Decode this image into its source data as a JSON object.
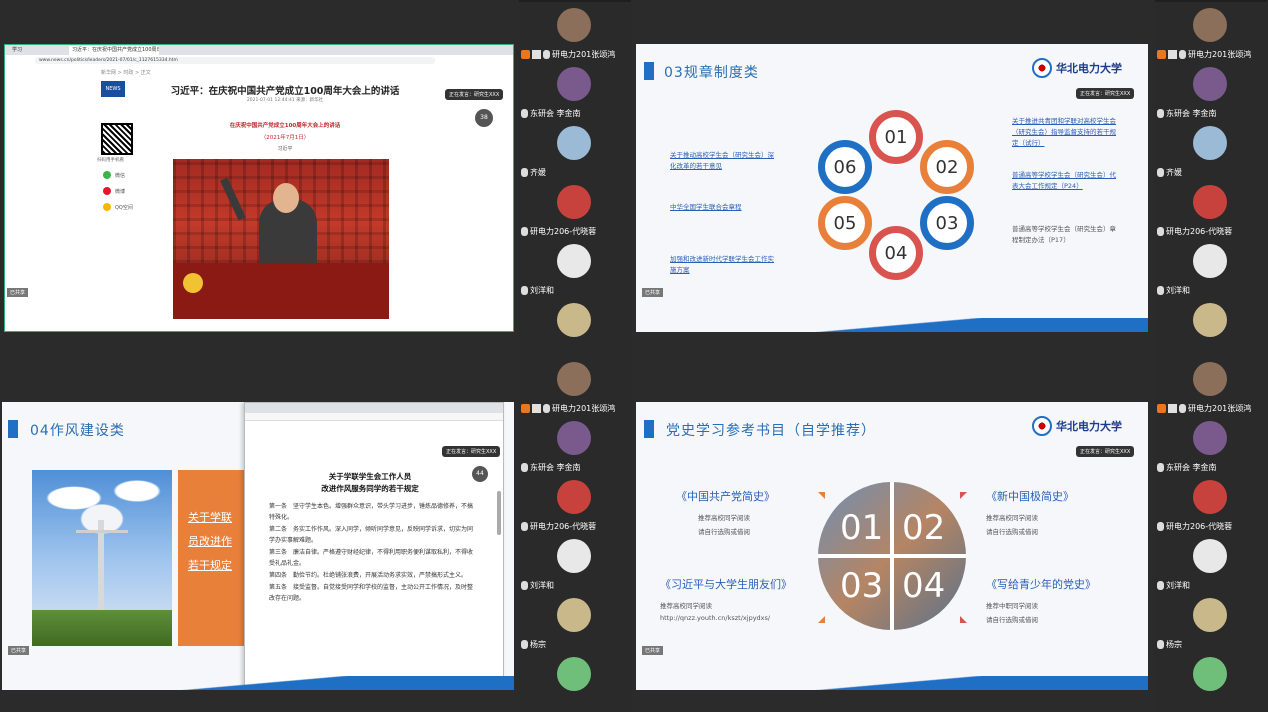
{
  "q1": {
    "browser_tabs": [
      "学习",
      "习近平：在庆祝中国共产党成立100周年..."
    ],
    "url": "www.news.cn/politics/leaders/2021-07/01/c_1127615334.htm",
    "breadcrumb": "新华网 > 时政 > 正文",
    "headline": "习近平：在庆祝中国共产党成立100周年大会上的讲话",
    "meta": "2021-07-01 12:44:41    来源：新华社",
    "red_title": "在庆祝中国共产党成立100周年大会上的讲话",
    "red_date": "（2021年7月1日）",
    "author": "习近平",
    "sidebar_note": "扫码用手机看",
    "share_items": [
      "微信",
      "微博",
      "QQ空间"
    ],
    "float_btn": "正在发言：研究生XXX",
    "zoom_badge": "38",
    "corner": "已共享"
  },
  "q2": {
    "title": "03规章制度类",
    "logo": "华北电力大学",
    "logo_en": "NORTH CHINA ELECTRIC POWER UNIVERSITY",
    "petals": [
      "01",
      "02",
      "03",
      "04",
      "05",
      "06"
    ],
    "left_items": [
      "关于推动高校学生会（研究生会）深化改革的若干意见",
      "中华全国学生联合会章程",
      "加强和改进新时代学联学生会工作实施方案"
    ],
    "right_items": [
      "关于推进共青团和学联对高校学生会（研究生会）指导监督支持的若干规定（试行）",
      "普通高等学校学生会（研究生会）代表大会工作规定（P24）",
      "普通高等学校学生会（研究生会）章程制定办法（P17）"
    ],
    "float_btn": "正在发言：研究生XXX",
    "corner": "已共享"
  },
  "q3": {
    "title": "04作风建设类",
    "orange_text": [
      "关于学联",
      "员改进作",
      "若干规定"
    ],
    "doc_title_1": "关于学联学生会工作人员",
    "doc_title_2": "改进作风服务同学的若干规定",
    "doc_paras": [
      "第一条　坚守学生本色。增强群众意识，带头学习进步，锤炼品德修养，不搞特殊化。",
      "第二条　务实工作作风。深入同学，倾听同学意见，反映同学诉求，切实为同学办实事解难题。",
      "第三条　廉洁自律。严格遵守财经纪律，不得利用职务便利谋取私利，不得收受礼品礼金。",
      "第四条　勤俭节约。杜绝铺张浪费，开展活动务求实效，严禁搞形式主义。",
      "第五条　接受监督。自觉接受同学和学校的监督，主动公开工作情况，及时整改存在问题。"
    ],
    "float_btn": "正在发言：研究生XXX",
    "zoom_badge": "44",
    "corner": "已共享"
  },
  "q4": {
    "title": "党史学习参考书目（自学推荐）",
    "logo": "华北电力大学",
    "center_numbers": [
      "01",
      "02",
      "03",
      "04"
    ],
    "books": [
      {
        "name": "《中国共产党简史》",
        "lines": [
          "推荐高校同学阅读",
          "请自行选购或借阅"
        ]
      },
      {
        "name": "《新中国极简史》",
        "lines": [
          "推荐高校同学阅读",
          "请自行选购或借阅"
        ]
      },
      {
        "name": "《习近平与大学生朋友们》",
        "lines": [
          "推荐高校同学阅读",
          "http://qnzz.youth.cn/kszt/xjpydxs/"
        ]
      },
      {
        "name": "《写给青少年的党史》",
        "lines": [
          "推荐中职同学阅读",
          "请自行选购或借阅"
        ]
      }
    ],
    "float_btn": "正在发言：研究生XXX",
    "corner": "已共享"
  },
  "gallery_left": [
    {
      "name": "研电力201张颂鸿",
      "badge": true
    },
    {
      "name": "东研会 李金南"
    },
    {
      "name": "齐媛"
    },
    {
      "name": "研电力206-代晓蓉"
    },
    {
      "name": "刘洋和"
    },
    {
      "name": ""
    },
    {
      "name": "研电力201张颂鸿",
      "badge": true
    },
    {
      "name": "东研会 李金南"
    },
    {
      "name": "研电力206-代晓蓉"
    },
    {
      "name": "刘洋和"
    },
    {
      "name": "杨宗"
    },
    {
      "name": ""
    }
  ],
  "gallery_right": [
    {
      "name": "研电力201张颂鸿",
      "badge": true
    },
    {
      "name": "东研会 李金南"
    },
    {
      "name": "齐媛"
    },
    {
      "name": "研电力206-代晓蓉"
    },
    {
      "name": "刘洋和"
    },
    {
      "name": ""
    },
    {
      "name": "研电力201张颂鸿",
      "badge": true
    },
    {
      "name": "东研会 李金南"
    },
    {
      "name": "研电力206-代晓蓉"
    },
    {
      "name": "刘洋和"
    },
    {
      "name": "杨宗"
    },
    {
      "name": ""
    }
  ],
  "colors": {
    "accent_blue": "#1f6fc5",
    "orange": "#e8803a",
    "red": "#d9534f",
    "teal": "#2bb673"
  }
}
